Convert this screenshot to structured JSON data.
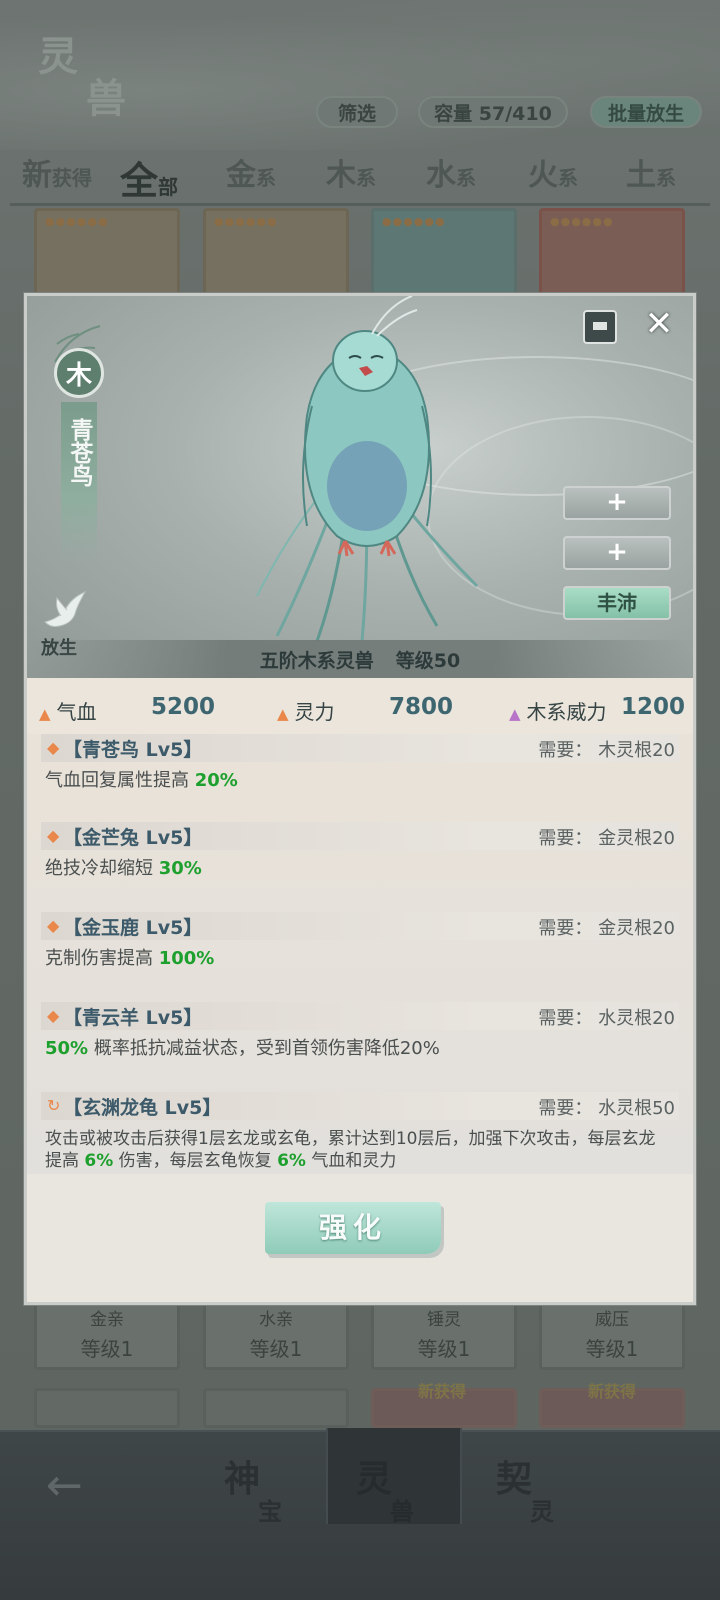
{
  "header": {
    "logo_char_1": "灵",
    "logo_char_2": "兽",
    "filter_label": "筛选",
    "capacity_label": "容量 57/410",
    "batch_release_label": "批量放生"
  },
  "tabs": [
    {
      "big": "新",
      "small": "获得"
    },
    {
      "big": "全",
      "small": "部"
    },
    {
      "big": "金",
      "small": "系"
    },
    {
      "big": "木",
      "small": "系"
    },
    {
      "big": "水",
      "small": "系"
    },
    {
      "big": "火",
      "small": "系"
    },
    {
      "big": "土",
      "small": "系"
    }
  ],
  "background_cards_bottom": [
    {
      "name": "金亲",
      "level": "等级1"
    },
    {
      "name": "水亲",
      "level": "等级1"
    },
    {
      "name": "锤灵",
      "level": "等级1"
    },
    {
      "name": "威压",
      "level": "等级1"
    }
  ],
  "new_tags": [
    "新获得",
    "新获得"
  ],
  "bottom_nav": {
    "items": [
      {
        "c1": "神",
        "c2": "宝"
      },
      {
        "c1": "灵",
        "c2": "兽"
      },
      {
        "c1": "契",
        "c2": "灵"
      }
    ]
  },
  "beast": {
    "element": "木",
    "name": "青苍鸟",
    "release_label": "放生",
    "grade_desc": "五阶木系灵兽",
    "level_desc": "等级50",
    "side_buttons": [
      "+",
      "+",
      "丰沛"
    ]
  },
  "stats": [
    {
      "label": "气血",
      "value": "5200",
      "color": "#e9884a"
    },
    {
      "label": "灵力",
      "value": "7800",
      "color": "#e9884a"
    },
    {
      "label": "木系威力",
      "value": "1200",
      "color": "#b774c9"
    }
  ],
  "skills": [
    {
      "icon": "diamond",
      "name": "【青苍鸟 Lv5】",
      "req": "需要： 木灵根20",
      "desc_pre": "气血回复属性提高 ",
      "desc_hl": "20%",
      "desc_post": ""
    },
    {
      "icon": "diamond",
      "name": "【金芒兔 Lv5】",
      "req": "需要： 金灵根20",
      "desc_pre": "绝技冷却缩短 ",
      "desc_hl": "30%",
      "desc_post": ""
    },
    {
      "icon": "diamond",
      "name": "【金玉鹿 Lv5】",
      "req": "需要： 金灵根20",
      "desc_pre": "克制伤害提高 ",
      "desc_hl": "100%",
      "desc_post": ""
    },
    {
      "icon": "diamond",
      "name": "【青云羊 Lv5】",
      "req": "需要： 水灵根20",
      "desc_pre": "",
      "desc_hl": "50%",
      "desc_post": " 概率抵抗减益状态，受到首领伤害降低20%"
    },
    {
      "icon": "cycle",
      "name": "【玄渊龙龟 Lv5】",
      "req": "需要： 水灵根50",
      "desc_line1": "攻击或被攻击后获得1层玄龙或玄龟，累计达到10层后，加强下次攻击，每层玄龙",
      "desc_line2_pre": "提高 ",
      "desc_line2_hl1": "6%",
      "desc_line2_mid": " 伤害，每层玄龟恢复 ",
      "desc_line2_hl2": "6%",
      "desc_line2_post": " 气血和灵力"
    }
  ],
  "enhance_label": "强化",
  "colors": {
    "highlight": "#1ea02e",
    "accent_green": "#8fcbb8",
    "skill_name": "#3c5a6a"
  }
}
